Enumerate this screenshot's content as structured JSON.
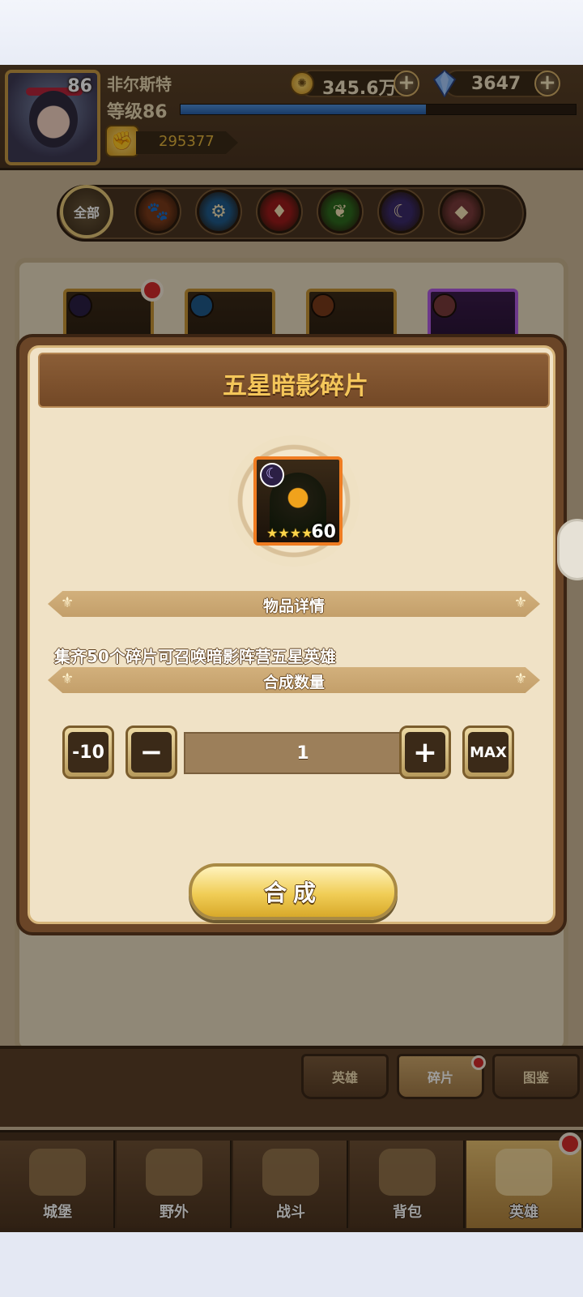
{
  "header": {
    "avatar_level": "86",
    "player_name": "非尔斯特",
    "level_label": "等级86",
    "xp_fraction": 0.62,
    "power_value": "295377",
    "gold_value": "345.6万",
    "gem_value": "3647",
    "plus_symbol": "+"
  },
  "filters": {
    "all_label": "全部",
    "factions": [
      {
        "name": "beast",
        "glyph": "🐾",
        "color": "#7a3a1a"
      },
      {
        "name": "mech",
        "glyph": "⚙",
        "color": "#1f5a8a"
      },
      {
        "name": "fire",
        "glyph": "♦",
        "color": "#9a1a1a"
      },
      {
        "name": "nature",
        "glyph": "❦",
        "color": "#2e6a1e"
      },
      {
        "name": "shadow",
        "glyph": "☾",
        "color": "#3a2a6a"
      },
      {
        "name": "light",
        "glyph": "◆",
        "color": "#7a3a3a"
      }
    ]
  },
  "modal": {
    "title": "五星暗影碎片",
    "item": {
      "stars": "★★★★",
      "count": "60",
      "faction_icon": "moon-icon"
    },
    "details_heading": "物品详情",
    "description": "集齐50个碎片可召唤暗影阵营五星英雄",
    "quantity_heading": "合成数量",
    "buttons": {
      "minus_ten": "-10",
      "minus": "−",
      "plus": "+",
      "max": "MAX"
    },
    "quantity_value": "1",
    "combine_label": "合成"
  },
  "subtabs": [
    {
      "label": "英雄",
      "active": false
    },
    {
      "label": "碎片",
      "active": true
    },
    {
      "label": "图鉴",
      "active": false
    }
  ],
  "nav": [
    {
      "label": "城堡",
      "active": false
    },
    {
      "label": "野外",
      "active": false
    },
    {
      "label": "战斗",
      "active": false
    },
    {
      "label": "背包",
      "active": false
    },
    {
      "label": "英雄",
      "active": true
    }
  ]
}
